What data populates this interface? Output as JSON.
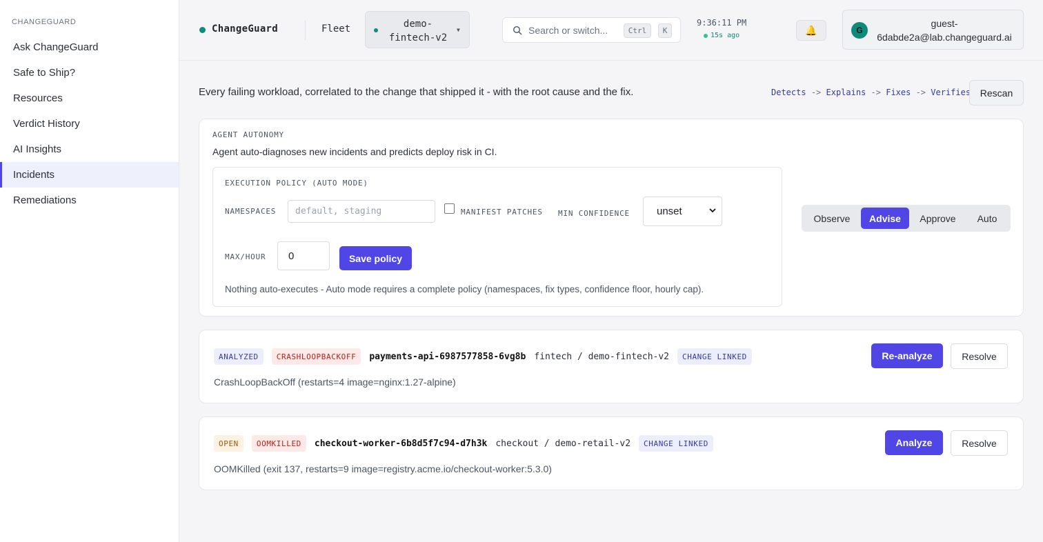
{
  "sidebar": {
    "brand": "CHANGEGUARD",
    "items": [
      {
        "label": "Ask ChangeGuard"
      },
      {
        "label": "Safe to Ship?"
      },
      {
        "label": "Resources"
      },
      {
        "label": "Verdict History"
      },
      {
        "label": "AI Insights"
      },
      {
        "label": "Incidents",
        "active": true
      },
      {
        "label": "Remediations"
      }
    ]
  },
  "header": {
    "app_name": "ChangeGuard",
    "fleet_label": "Fleet",
    "environment": "demo-fintech-v2",
    "search_placeholder": "Search or switch...",
    "shortcut_keys": [
      "Ctrl",
      "K"
    ],
    "time": "9:36:11 PM",
    "last_updated": "15s ago",
    "bell_icon": "🔔",
    "user": {
      "initial": "G",
      "email": "guest-6dabde2a@lab.changeguard.ai"
    }
  },
  "intro": {
    "text": "Every failing workload, correlated to the change that shipped it - with the root cause and the fix.",
    "flow": [
      "Detects",
      "Explains",
      "Fixes",
      "Verifies"
    ],
    "flow_separator": "->",
    "rescan_label": "Rescan"
  },
  "autonomy": {
    "title": "AGENT AUTONOMY",
    "description": "Agent auto-diagnoses new incidents and predicts deploy risk in CI.",
    "policy": {
      "title": "EXECUTION POLICY (AUTO MODE)",
      "namespaces_label": "NAMESPACES",
      "namespaces_placeholder": "default, staging",
      "manifest_patches_label": "MANIFEST PATCHES",
      "manifest_patches_checked": false,
      "min_confidence_label": "MIN CONFIDENCE",
      "min_confidence_value": "unset",
      "max_hour_label": "MAX/HOUR",
      "max_hour_value": "0",
      "save_label": "Save policy",
      "note": "Nothing auto-executes - Auto mode requires a complete policy (namespaces, fix types, confidence floor, hourly cap)."
    },
    "modes": [
      "Observe",
      "Advise",
      "Approve",
      "Auto"
    ],
    "active_mode": "Advise"
  },
  "incidents": [
    {
      "status": "ANALYZED",
      "reason": "CRASHLOOPBACKOFF",
      "pod": "payments-api-6987577858-6vg8b",
      "namespace": "fintech / demo-fintech-v2",
      "link_badge": "CHANGE LINKED",
      "detail": "CrashLoopBackOff (restarts=4 image=nginx:1.27-alpine)",
      "primary_action": "Re-analyze",
      "secondary_action": "Resolve"
    },
    {
      "status": "OPEN",
      "reason": "OOMKILLED",
      "pod": "checkout-worker-6b8d5f7c94-d7h3k",
      "namespace": "checkout / demo-retail-v2",
      "link_badge": "CHANGE LINKED",
      "detail": "OOMKilled (exit 137, restarts=9 image=registry.acme.io/checkout-worker:5.3.0)",
      "primary_action": "Analyze",
      "secondary_action": "Resolve"
    }
  ],
  "colors": {
    "accent": "#4f46e5",
    "teal": "#0f8b7b",
    "danger_bg": "#fde9e7",
    "danger_text": "#b42318"
  }
}
